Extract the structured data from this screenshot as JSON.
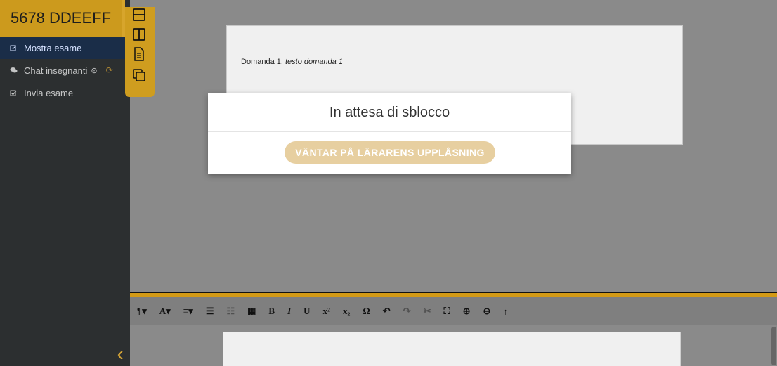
{
  "student": {
    "code": "5678 DDEEFF"
  },
  "sidebar": {
    "items": [
      {
        "icon": "edit-icon",
        "label": "Mostra esame"
      },
      {
        "icon": "chat-icon",
        "label": "Chat insegnanti"
      },
      {
        "icon": "submit-check-icon",
        "label": "Invia esame"
      }
    ],
    "chat_status": "⊙"
  },
  "layout_toolbar": {
    "buttons": [
      {
        "icon": "layout-horizontal-split-icon"
      },
      {
        "icon": "layout-vertical-split-icon"
      },
      {
        "icon": "document-icon"
      },
      {
        "icon": "copy-windows-icon"
      }
    ]
  },
  "question": {
    "label": "Domanda 1.",
    "text": "testo domanda 1"
  },
  "modal": {
    "title": "In attesa di sblocco",
    "button_label": "VÄNTAR PÅ LÄRARENS UPPLÅSNING"
  },
  "editor_toolbar": {
    "buttons": [
      {
        "icon": "paragraph-icon",
        "label": "¶▾"
      },
      {
        "icon": "font-size-icon",
        "label": "A▾"
      },
      {
        "icon": "align-icon",
        "label": "≡▾"
      },
      {
        "icon": "indent-icon",
        "label": "☰"
      },
      {
        "icon": "outdent-icon",
        "label": "☷"
      },
      {
        "icon": "table-icon",
        "label": "▦"
      },
      {
        "icon": "bold-icon",
        "label": "B"
      },
      {
        "icon": "italic-icon",
        "label": "I"
      },
      {
        "icon": "underline-icon",
        "label": "U"
      },
      {
        "icon": "superscript-icon",
        "label": "x²"
      },
      {
        "icon": "subscript-icon",
        "label": "x₂"
      },
      {
        "icon": "omega-icon",
        "label": "Ω"
      },
      {
        "icon": "undo-icon",
        "label": "↶"
      },
      {
        "icon": "redo-icon",
        "label": "↷"
      },
      {
        "icon": "cut-icon",
        "label": "✂"
      },
      {
        "icon": "puzzle-icon",
        "label": "⛶"
      },
      {
        "icon": "zoom-in-icon",
        "label": "⊕"
      },
      {
        "icon": "zoom-out-icon",
        "label": "⊖"
      },
      {
        "icon": "up-arrow-icon",
        "label": "↑"
      }
    ]
  },
  "colors": {
    "accent": "#cf9d1f",
    "sidebar": "#2c2f30",
    "overlay": "#8a8a8a"
  }
}
